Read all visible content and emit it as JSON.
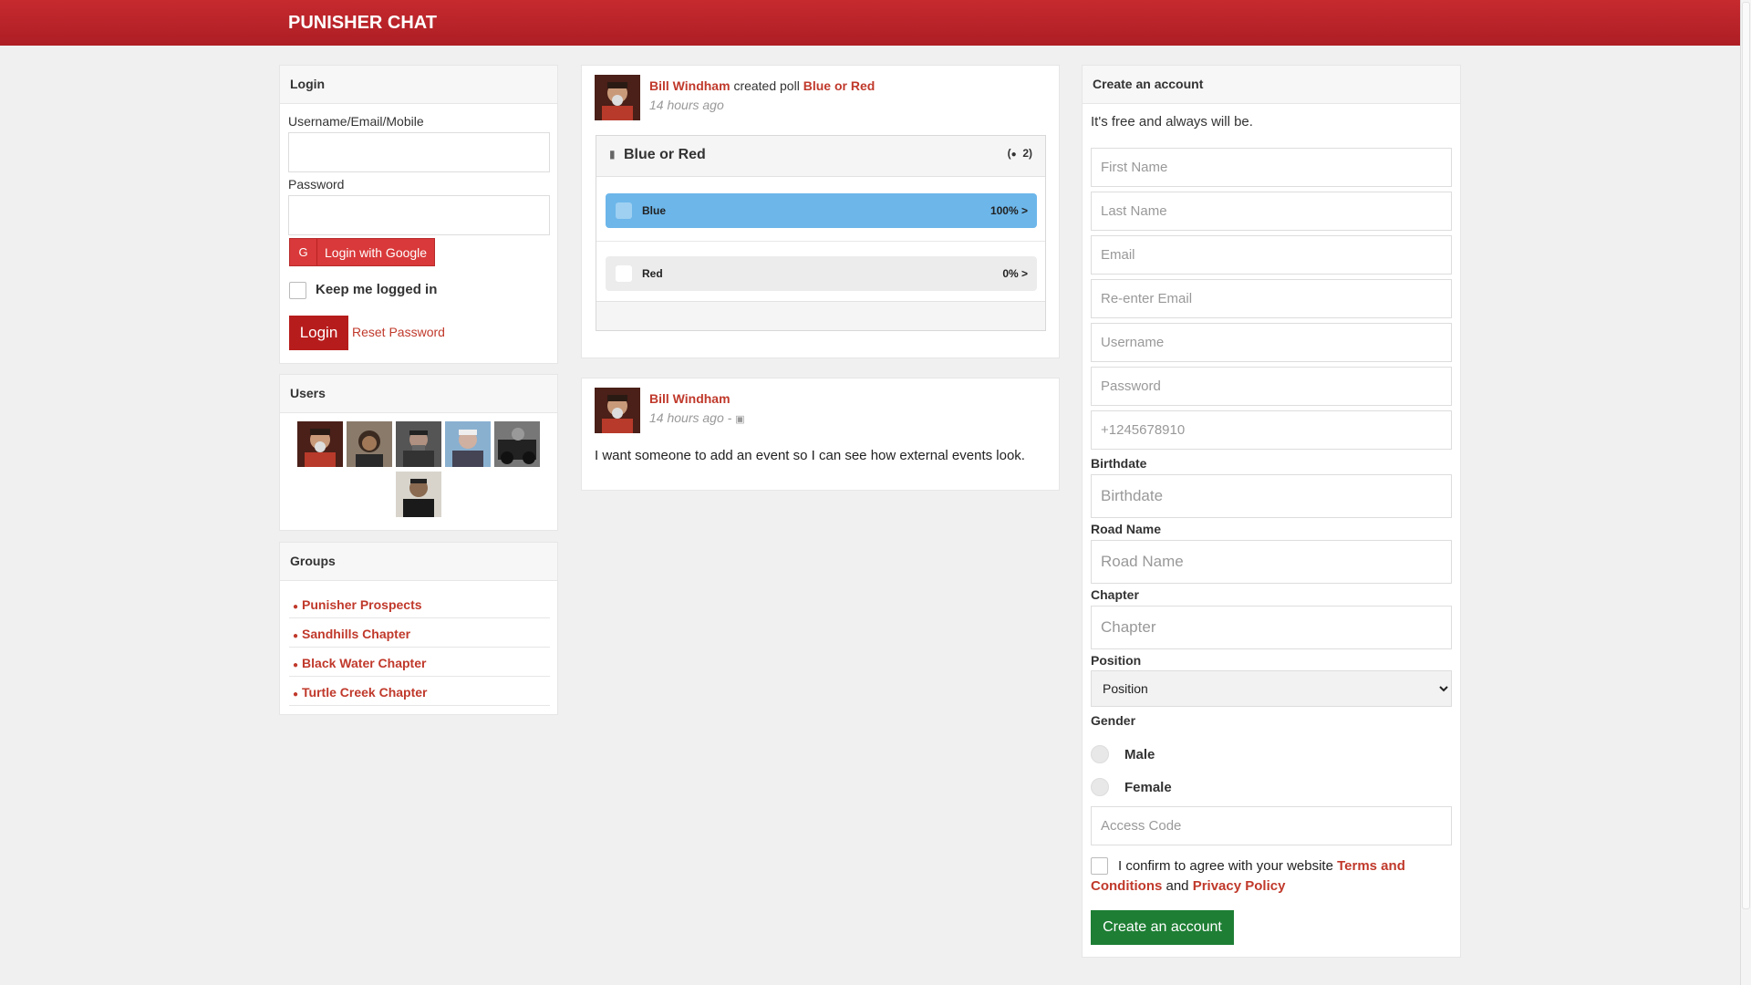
{
  "brand": "PUNISHER CHAT",
  "login": {
    "title": "Login",
    "username_label": "Username/Email/Mobile",
    "username_value": "",
    "password_label": "Password",
    "password_value": "",
    "google_label": "Login with Google",
    "keep_logged_label": "Keep me logged in",
    "login_button": "Login",
    "reset_link": "Reset Password"
  },
  "users": {
    "title": "Users",
    "count": 6
  },
  "groups": {
    "title": "Groups",
    "items": [
      "Punisher Prospects",
      "Sandhills Chapter",
      "Black Water Chapter",
      "Turtle Creek Chapter"
    ]
  },
  "feed": {
    "post1": {
      "author": "Bill Windham",
      "action": "created poll",
      "poll_link": "Blue or Red",
      "time": "14 hours ago",
      "poll": {
        "title": "Blue or Red",
        "votes": "2",
        "options": [
          {
            "label": "Blue",
            "percent": "100% >",
            "value": 100
          },
          {
            "label": "Red",
            "percent": "0% >",
            "value": 0
          }
        ]
      }
    },
    "post2": {
      "author": "Bill Windham",
      "time": "14 hours ago -",
      "text": "I want someone to add an event so I can see how external events look."
    }
  },
  "register": {
    "title": "Create an account",
    "subtitle": "It's free and always will be.",
    "first_name_ph": "First Name",
    "last_name_ph": "Last Name",
    "email_ph": "Email",
    "reemail_ph": "Re-enter Email",
    "username_ph": "Username",
    "password_ph": "Password",
    "phone_ph": "+1245678910",
    "birthdate_label": "Birthdate",
    "birthdate_ph": "Birthdate",
    "road_label": "Road Name",
    "road_ph": "Road Name",
    "chapter_label": "Chapter",
    "chapter_ph": "Chapter",
    "position_label": "Position",
    "position_value": "Position",
    "gender_label": "Gender",
    "male": "Male",
    "female": "Female",
    "access_ph": "Access Code",
    "confirm_text": "I confirm to agree with your website",
    "terms_link": "Terms and Conditions",
    "and_text": "and",
    "privacy_link": "Privacy Policy",
    "create_button": "Create an account"
  },
  "colors": {
    "brand_red": "#c62a2f",
    "poll_blue": "#6cb6ea",
    "create_green": "#1e7e34"
  }
}
